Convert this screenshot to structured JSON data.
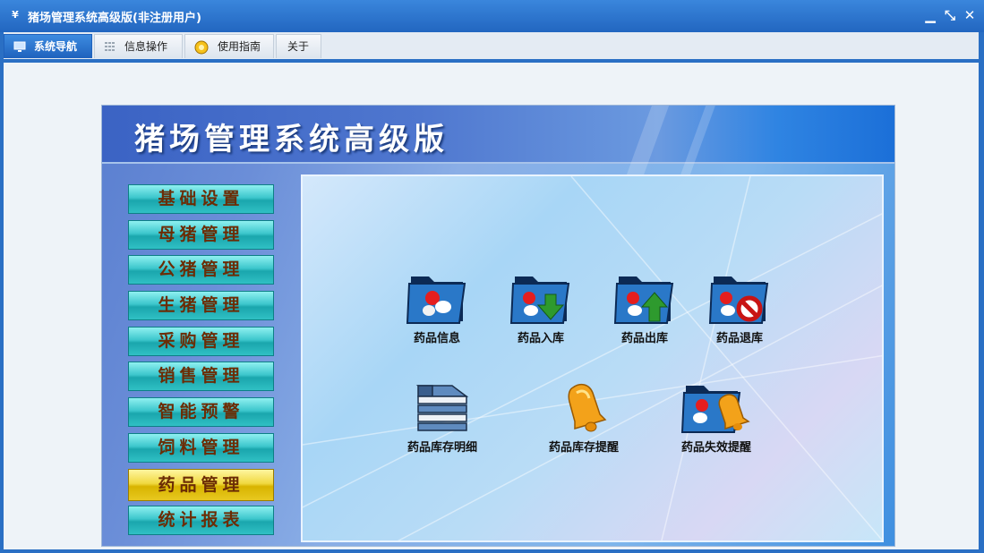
{
  "window": {
    "title": "猪场管理系统高级版(非注册用户)",
    "minimize_glyph": "▁",
    "restore_glyph": "⤡",
    "close_glyph": "✕"
  },
  "tabs": [
    {
      "label": "系统导航",
      "icon": "monitor-icon",
      "active": true
    },
    {
      "label": "信息操作",
      "icon": "grid-icon",
      "active": false
    },
    {
      "label": "使用指南",
      "icon": "help-circle-icon",
      "active": false
    },
    {
      "label": "关于",
      "icon": "",
      "active": false
    }
  ],
  "banner": {
    "title": "猪场管理系统高级版"
  },
  "nav": [
    {
      "label": "基础设置",
      "selected": false
    },
    {
      "label": "母猪管理",
      "selected": false
    },
    {
      "label": "公猪管理",
      "selected": false
    },
    {
      "label": "生猪管理",
      "selected": false
    },
    {
      "label": "采购管理",
      "selected": false
    },
    {
      "label": "销售管理",
      "selected": false
    },
    {
      "label": "智能预警",
      "selected": false
    },
    {
      "label": "饲料管理",
      "selected": false
    },
    {
      "label": "药品管理",
      "selected": true
    },
    {
      "label": "统计报表",
      "selected": false
    }
  ],
  "functions": [
    {
      "label": "药品信息",
      "icon": "medicine-folder-icon"
    },
    {
      "label": "药品入库",
      "icon": "medicine-folder-down-arrow-icon"
    },
    {
      "label": "药品出库",
      "icon": "medicine-folder-up-arrow-icon"
    },
    {
      "label": "药品退库",
      "icon": "medicine-folder-prohibit-icon"
    },
    {
      "label": "药品库存明细",
      "icon": "book-stack-icon"
    },
    {
      "label": "药品库存提醒",
      "icon": "bell-icon"
    },
    {
      "label": "药品失效提醒",
      "icon": "medicine-folder-bell-icon"
    }
  ],
  "colors": {
    "accent": "#2a6fc4",
    "nav_button": "#3cc6cc",
    "nav_selected": "#e8c820",
    "nav_text": "#6b2c05"
  }
}
